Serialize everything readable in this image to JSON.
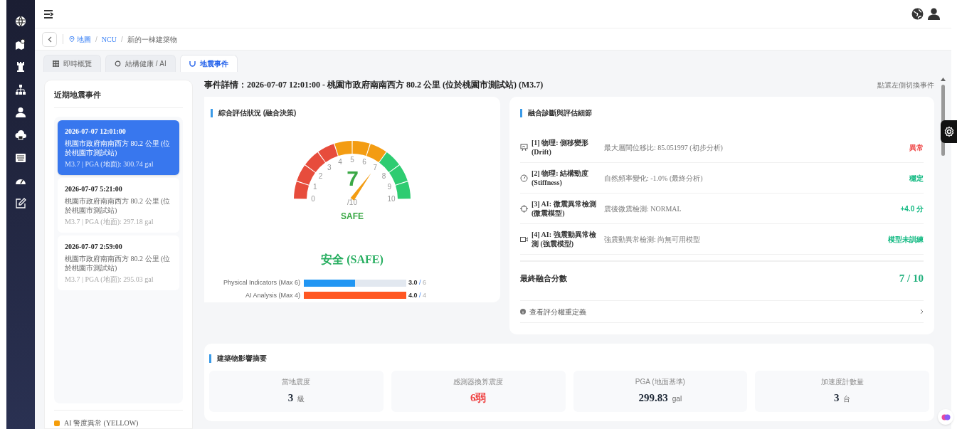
{
  "breadcrumb": [
    {
      "label": "地圖"
    },
    {
      "separator": "/",
      "label": "NCU"
    },
    {
      "separator": "/",
      "label": "新的一棟建築物"
    }
  ],
  "tabs": [
    {
      "label": "即時概覽",
      "selected": false
    },
    {
      "label": "結構健康 / AI",
      "selected": false
    },
    {
      "label": "地震事件",
      "selected": true
    }
  ],
  "events_panel": {
    "title": "近期地震事件",
    "events": [
      {
        "time": "2026-07-07 12:01:00",
        "location": "桃園市政府南南西方 80.2 公里 (位於桃園市測試站)",
        "meta": "M3.7 | PGA (地面): 300.74 gal",
        "selected": true
      },
      {
        "time": "2026-07-07 5:21:00",
        "location": "桃園市政府南南西方 80.2 公里 (位於桃園市測試站)",
        "meta": "M3.7 | PGA (地面): 297.18 gal",
        "selected": false
      },
      {
        "time": "2026-07-07 2:59:00",
        "location": "桃園市政府南南西方 80.2 公里 (位於桃園市測試站)",
        "meta": "M3.7 | PGA (地面): 295.03 gal",
        "selected": false
      }
    ],
    "legend": {
      "label": "AI 警度異常 (YELLOW)",
      "color": "#f59e0b"
    }
  },
  "detail_title": "事件詳情：2026-07-07 12:01:00 - 桃園市政府南南西方 80.2 公里 (位於桃園市測試站) (M3.7)",
  "detail_hint": "點選左側切換事件",
  "assessment": {
    "title": "綜合評估狀況 (融合決策)",
    "gauge": {
      "score": "7",
      "max": "/10",
      "label": "SAFE",
      "ticks": [
        "0",
        "1",
        "2",
        "3",
        "4",
        "5",
        "6",
        "7",
        "8",
        "9",
        "10"
      ]
    },
    "status": "安全 (SAFE)",
    "bars": [
      {
        "label": "Physical Indicators (Max 6)",
        "value": "3.0",
        "separator": "/",
        "max": "6",
        "level": 0.5,
        "color": "#2196f3"
      },
      {
        "label": "AI Analysis (Max 4)",
        "value": "4.0",
        "separator": "/",
        "max": "4",
        "level": 1.0,
        "color": "#ff5722"
      }
    ]
  },
  "fusion": {
    "title": "融合診斷與評估細節",
    "items": [
      {
        "title": "[1] 物理: 側移變形 (Drift)",
        "detail": "最大層間位移比: 85.051997 (初步分析)",
        "status": "異常",
        "color": "#ef4444"
      },
      {
        "title": "[2] 物理: 結構勁度 (Stiffness)",
        "detail": "自然頻率變化: -1.0% (最終分析)",
        "status": "穩定",
        "color": "#10b981"
      },
      {
        "title": "[3] AI: 微震異常檢測 (微震模型)",
        "detail": "震後微震檢測: NORMAL",
        "status": "+4.0 分",
        "color": "#10b981"
      },
      {
        "title": "[4] AI: 強震動異常檢測 (強震模型)",
        "detail": "強震動異常檢測: 尚無可用模型",
        "status": "模型未訓練",
        "color": "#10b981"
      }
    ],
    "final_label": "最終融合分數",
    "final_score": "7 / 10",
    "link": "查看評分權重定義"
  },
  "summary": {
    "title": "建築物影響摘要",
    "cards": [
      {
        "label": "當地震度",
        "value": "3",
        "unit": "級",
        "color": "#1f2937"
      },
      {
        "label": "感測器換算震度",
        "value": "6弱",
        "color": "#ef4444"
      },
      {
        "label": "PGA (地面基準)",
        "value": "299.83",
        "unit": "gal",
        "color": "#1f2937"
      },
      {
        "label": "加速度計數量",
        "value": "3",
        "unit": "台",
        "color": "#1f2937"
      }
    ]
  }
}
